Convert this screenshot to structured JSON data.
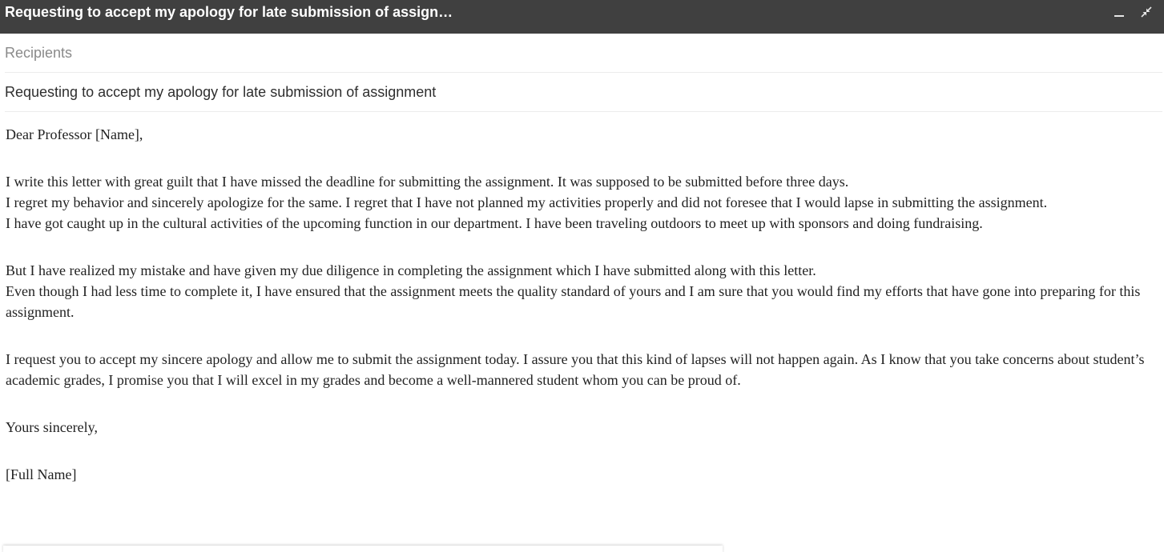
{
  "window": {
    "title": "Requesting to accept my apology for late submission of assign…",
    "minimize_icon": "minimize-icon",
    "exit_fullscreen_icon": "exit-fullscreen-icon"
  },
  "compose": {
    "recipients_placeholder": "Recipients",
    "subject": "Requesting to accept my apology for late submission of assignment",
    "body": {
      "salutation": "Dear Professor [Name],",
      "paragraph_1": "I write this letter with great guilt that I have missed the deadline for submitting the assignment. It was supposed to be submitted before three days.\nI regret my behavior and sincerely apologize for the same. I regret that I have not planned my activities properly and did not foresee that I would lapse in submitting the assignment.\nI have got caught up in the cultural activities of the upcoming function in our department. I have been traveling outdoors to meet up with sponsors and doing fundraising.",
      "paragraph_2": "But I have realized my mistake and have given my due diligence in completing the assignment which I have submitted along with this letter.\nEven though I had less time to complete it, I have ensured that the assignment meets the quality standard of yours and I am sure that you would find my efforts that have gone into preparing for this assignment.",
      "paragraph_3": "I request you to accept my sincere apology and allow me to submit the assignment today. I assure you that this kind of lapses will not happen again. As I know that you take concerns about student’s academic grades, I promise you that I will excel in my grades and become a well-mannered student whom you can be proud of.",
      "closing": "Yours sincerely,",
      "signature": "[Full Name]"
    }
  }
}
